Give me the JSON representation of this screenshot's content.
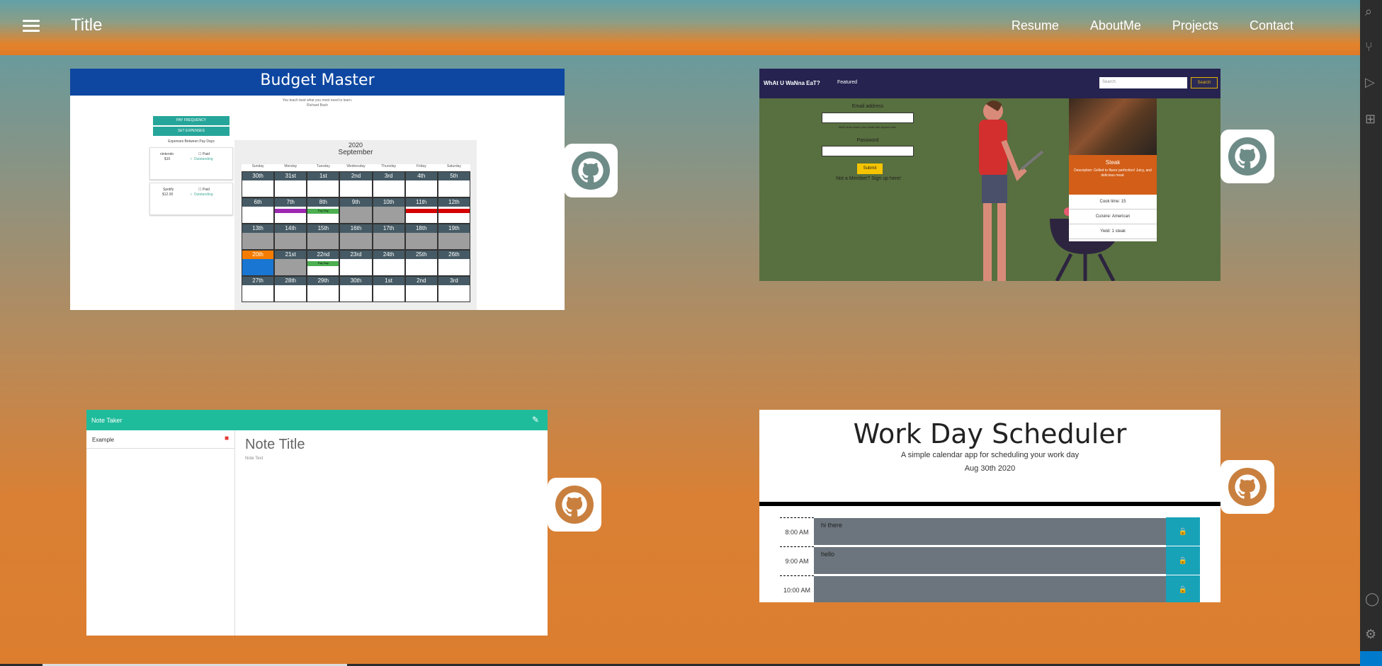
{
  "nav": {
    "title": "Title",
    "links": [
      "Resume",
      "AboutMe",
      "Projects",
      "Contact"
    ]
  },
  "budget": {
    "title": "Budget Master",
    "quote_line1": "You teach best what you most need to learn.",
    "quote_line2": "Richard Bach",
    "btn_pay": "PAY FREQUENCY",
    "btn_exp": "SET EXPENSES",
    "expenses_label": "Expenses Between Pay Days",
    "items": [
      {
        "name": "nintendo",
        "amount": "$10",
        "paid": "Paid",
        "outstanding": "Outstanding"
      },
      {
        "name": "Spotify",
        "amount": "$12.00",
        "paid": "Paid",
        "outstanding": "Outstanding"
      }
    ],
    "cal_year": "2020",
    "cal_month": "September",
    "dow": [
      "Sunday",
      "Monday",
      "Tuesday",
      "Wednesday",
      "Thursday",
      "Friday",
      "Saturday"
    ],
    "weeks": [
      [
        "30th",
        "31st",
        "1st",
        "2nd",
        "3rd",
        "4th",
        "5th"
      ],
      [
        "6th",
        "7th",
        "8th",
        "9th",
        "10th",
        "11th",
        "12th"
      ],
      [
        "13th",
        "14th",
        "15th",
        "16th",
        "17th",
        "18th",
        "19th"
      ],
      [
        "20th",
        "21st",
        "22nd",
        "23rd",
        "24th",
        "25th",
        "26th"
      ],
      [
        "27th",
        "28th",
        "29th",
        "30th",
        "1st",
        "2nd",
        "3rd"
      ]
    ],
    "payday": "Pay Day"
  },
  "food": {
    "brand": "WhAt U WaNna EaT?",
    "featured": "Featured",
    "search_placeholder": "Search",
    "search_btn": "Search",
    "email_label": "Email address",
    "email_hint": "We'll never share your email with anyone else.",
    "password_label": "Password",
    "submit": "Submit",
    "signup": "Not a Member? Sign up here!",
    "card_title": "Steak",
    "card_desc": "Description: Grilled to flavor perfection! Juicy, and delicious meat.",
    "cook_time": "Cook time: 15",
    "cuisine": "Cuisine: American",
    "yield": "Yield: 1 steak"
  },
  "note": {
    "app": "Note Taker",
    "item": "Example",
    "title": "Note Title",
    "text": "Note Text"
  },
  "sched": {
    "title": "Work Day Scheduler",
    "subtitle": "A simple calendar app for scheduling your work day",
    "date": "Aug 30th 2020",
    "rows": [
      {
        "hour": "8:00 AM",
        "text": "hi there"
      },
      {
        "hour": "9:00 AM",
        "text": "hello"
      },
      {
        "hour": "10:00 AM",
        "text": ""
      }
    ]
  }
}
